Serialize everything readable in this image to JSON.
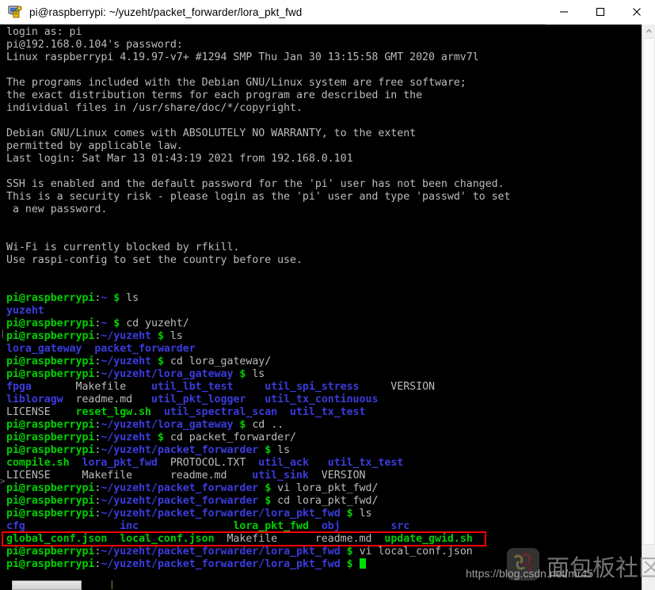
{
  "window": {
    "title": "pi@raspberrypi: ~/yuzeht/packet_forwarder/lora_pkt_fwd",
    "icon": "putty-computer-icon",
    "controls": {
      "minimize": "minimize-icon",
      "maximize": "maximize-icon",
      "close": "close-icon"
    }
  },
  "terminal": {
    "colors": {
      "background": "#000000",
      "foreground": "#bbbbbb",
      "prompt_green": "#00d000",
      "directory_blue": "#3b3bdd",
      "executable_green": "#00d000",
      "cursor": "#00e000",
      "highlight_box": "#ff0000"
    },
    "lines": [
      {
        "segments": [
          {
            "text": "login as: pi",
            "color": "white"
          }
        ]
      },
      {
        "segments": [
          {
            "text": "pi@192.168.0.104's password:",
            "color": "white"
          }
        ]
      },
      {
        "segments": [
          {
            "text": "Linux raspberrypi 4.19.97-v7+ #1294 SMP Thu Jan 30 13:15:58 GMT 2020 armv7l",
            "color": "white"
          }
        ]
      },
      {
        "segments": [
          {
            "text": "",
            "color": "white"
          }
        ]
      },
      {
        "segments": [
          {
            "text": "The programs included with the Debian GNU/Linux system are free software;",
            "color": "white"
          }
        ]
      },
      {
        "segments": [
          {
            "text": "the exact distribution terms for each program are described in the",
            "color": "white"
          }
        ]
      },
      {
        "segments": [
          {
            "text": "individual files in /usr/share/doc/*/copyright.",
            "color": "white"
          }
        ]
      },
      {
        "segments": [
          {
            "text": "",
            "color": "white"
          }
        ]
      },
      {
        "segments": [
          {
            "text": "Debian GNU/Linux comes with ABSOLUTELY NO WARRANTY, to the extent",
            "color": "white"
          }
        ]
      },
      {
        "segments": [
          {
            "text": "permitted by applicable law.",
            "color": "white"
          }
        ]
      },
      {
        "segments": [
          {
            "text": "Last login: Sat Mar 13 01:43:19 2021 from 192.168.0.101",
            "color": "white"
          }
        ]
      },
      {
        "segments": [
          {
            "text": "",
            "color": "white"
          }
        ]
      },
      {
        "segments": [
          {
            "text": "SSH is enabled and the default password for the 'pi' user has not been changed.",
            "color": "white"
          }
        ]
      },
      {
        "segments": [
          {
            "text": "This is a security risk - please login as the 'pi' user and type 'passwd' to set",
            "color": "white"
          }
        ]
      },
      {
        "segments": [
          {
            "text": " a new password.",
            "color": "white"
          }
        ]
      },
      {
        "segments": [
          {
            "text": "",
            "color": "white"
          }
        ]
      },
      {
        "segments": [
          {
            "text": "",
            "color": "white"
          }
        ]
      },
      {
        "segments": [
          {
            "text": "Wi-Fi is currently blocked by rfkill.",
            "color": "white"
          }
        ]
      },
      {
        "segments": [
          {
            "text": "Use raspi-config to set the country before use.",
            "color": "white"
          }
        ]
      },
      {
        "segments": [
          {
            "text": "",
            "color": "white"
          }
        ]
      },
      {
        "segments": [
          {
            "text": "",
            "color": "white"
          }
        ]
      },
      {
        "segments": [
          {
            "text": "pi@raspberrypi",
            "color": "green"
          },
          {
            "text": ":",
            "color": "white"
          },
          {
            "text": "~",
            "color": "blue"
          },
          {
            "text": " ",
            "color": "white"
          },
          {
            "text": "$",
            "color": "green"
          },
          {
            "text": " ls",
            "color": "white"
          }
        ]
      },
      {
        "segments": [
          {
            "text": "yuzeht",
            "color": "blue"
          }
        ]
      },
      {
        "segments": [
          {
            "text": "pi@raspberrypi",
            "color": "green"
          },
          {
            "text": ":",
            "color": "white"
          },
          {
            "text": "~",
            "color": "blue"
          },
          {
            "text": " ",
            "color": "white"
          },
          {
            "text": "$",
            "color": "green"
          },
          {
            "text": " cd yuzeht/",
            "color": "white"
          }
        ]
      },
      {
        "segments": [
          {
            "text": "pi@raspberrypi",
            "color": "green"
          },
          {
            "text": ":",
            "color": "white"
          },
          {
            "text": "~/yuzeht",
            "color": "blue"
          },
          {
            "text": " ",
            "color": "white"
          },
          {
            "text": "$",
            "color": "green"
          },
          {
            "text": " ls",
            "color": "white"
          }
        ]
      },
      {
        "segments": [
          {
            "text": "lora_gateway",
            "color": "blue"
          },
          {
            "text": "  ",
            "color": "white"
          },
          {
            "text": "packet_forwarder",
            "color": "blue"
          }
        ]
      },
      {
        "segments": [
          {
            "text": "pi@raspberrypi",
            "color": "green"
          },
          {
            "text": ":",
            "color": "white"
          },
          {
            "text": "~/yuzeht",
            "color": "blue"
          },
          {
            "text": " ",
            "color": "white"
          },
          {
            "text": "$",
            "color": "green"
          },
          {
            "text": " cd lora_gateway/",
            "color": "white"
          }
        ]
      },
      {
        "segments": [
          {
            "text": "pi@raspberrypi",
            "color": "green"
          },
          {
            "text": ":",
            "color": "white"
          },
          {
            "text": "~/yuzeht/lora_gateway",
            "color": "blue"
          },
          {
            "text": " ",
            "color": "white"
          },
          {
            "text": "$",
            "color": "green"
          },
          {
            "text": " ls",
            "color": "white"
          }
        ]
      },
      {
        "segments": [
          {
            "text": "fpga",
            "color": "blue"
          },
          {
            "text": "       Makefile    ",
            "color": "white"
          },
          {
            "text": "util_lbt_test",
            "color": "blue"
          },
          {
            "text": "     ",
            "color": "white"
          },
          {
            "text": "util_spi_stress",
            "color": "blue"
          },
          {
            "text": "     VERSION",
            "color": "white"
          }
        ]
      },
      {
        "segments": [
          {
            "text": "libloragw",
            "color": "blue"
          },
          {
            "text": "  readme.md   ",
            "color": "white"
          },
          {
            "text": "util_pkt_logger",
            "color": "blue"
          },
          {
            "text": "   ",
            "color": "white"
          },
          {
            "text": "util_tx_continuous",
            "color": "blue"
          }
        ]
      },
      {
        "segments": [
          {
            "text": "LICENSE    ",
            "color": "white"
          },
          {
            "text": "reset_lgw.sh",
            "color": "green"
          },
          {
            "text": "  ",
            "color": "white"
          },
          {
            "text": "util_spectral_scan",
            "color": "blue"
          },
          {
            "text": "  ",
            "color": "white"
          },
          {
            "text": "util_tx_test",
            "color": "blue"
          }
        ]
      },
      {
        "segments": [
          {
            "text": "pi@raspberrypi",
            "color": "green"
          },
          {
            "text": ":",
            "color": "white"
          },
          {
            "text": "~/yuzeht/lora_gateway",
            "color": "blue"
          },
          {
            "text": " ",
            "color": "white"
          },
          {
            "text": "$",
            "color": "green"
          },
          {
            "text": " cd ..",
            "color": "white"
          }
        ]
      },
      {
        "segments": [
          {
            "text": "pi@raspberrypi",
            "color": "green"
          },
          {
            "text": ":",
            "color": "white"
          },
          {
            "text": "~/yuzeht",
            "color": "blue"
          },
          {
            "text": " ",
            "color": "white"
          },
          {
            "text": "$",
            "color": "green"
          },
          {
            "text": " cd packet_forwarder/",
            "color": "white"
          }
        ]
      },
      {
        "segments": [
          {
            "text": "pi@raspberrypi",
            "color": "green"
          },
          {
            "text": ":",
            "color": "white"
          },
          {
            "text": "~/yuzeht/packet_forwarder",
            "color": "blue"
          },
          {
            "text": " ",
            "color": "white"
          },
          {
            "text": "$",
            "color": "green"
          },
          {
            "text": " ls",
            "color": "white"
          }
        ]
      },
      {
        "segments": [
          {
            "text": "compile.sh",
            "color": "green"
          },
          {
            "text": "  ",
            "color": "white"
          },
          {
            "text": "lora_pkt_fwd",
            "color": "blue"
          },
          {
            "text": "  PROTOCOL.TXT  ",
            "color": "white"
          },
          {
            "text": "util_ack",
            "color": "blue"
          },
          {
            "text": "   ",
            "color": "white"
          },
          {
            "text": "util_tx_test",
            "color": "blue"
          }
        ]
      },
      {
        "segments": [
          {
            "text": "LICENSE     Makefile      readme.md    ",
            "color": "white"
          },
          {
            "text": "util_sink",
            "color": "blue"
          },
          {
            "text": "  VERSION",
            "color": "white"
          }
        ]
      },
      {
        "segments": [
          {
            "text": "pi@raspberrypi",
            "color": "green"
          },
          {
            "text": ":",
            "color": "white"
          },
          {
            "text": "~/yuzeht/packet_forwarder",
            "color": "blue"
          },
          {
            "text": " ",
            "color": "white"
          },
          {
            "text": "$",
            "color": "green"
          },
          {
            "text": " vi lora_pkt_fwd/",
            "color": "white"
          }
        ]
      },
      {
        "segments": [
          {
            "text": "pi@raspberrypi",
            "color": "green"
          },
          {
            "text": ":",
            "color": "white"
          },
          {
            "text": "~/yuzeht/packet_forwarder",
            "color": "blue"
          },
          {
            "text": " ",
            "color": "white"
          },
          {
            "text": "$",
            "color": "green"
          },
          {
            "text": " cd lora_pkt_fwd/",
            "color": "white"
          }
        ]
      },
      {
        "segments": [
          {
            "text": "pi@raspberrypi",
            "color": "green"
          },
          {
            "text": ":",
            "color": "white"
          },
          {
            "text": "~/yuzeht/packet_forwarder/lora_pkt_fwd",
            "color": "blue"
          },
          {
            "text": " ",
            "color": "white"
          },
          {
            "text": "$",
            "color": "green"
          },
          {
            "text": " ls",
            "color": "white"
          }
        ]
      },
      {
        "segments": [
          {
            "text": "cfg",
            "color": "blue"
          },
          {
            "text": "               ",
            "color": "white"
          },
          {
            "text": "inc",
            "color": "blue"
          },
          {
            "text": "               ",
            "color": "white"
          },
          {
            "text": "lora_pkt_fwd",
            "color": "green"
          },
          {
            "text": "  ",
            "color": "white"
          },
          {
            "text": "obj",
            "color": "blue"
          },
          {
            "text": "        ",
            "color": "white"
          },
          {
            "text": "src",
            "color": "blue"
          }
        ]
      },
      {
        "segments": [
          {
            "text": "global_conf.json",
            "color": "green"
          },
          {
            "text": "  ",
            "color": "white"
          },
          {
            "text": "local_conf.json",
            "color": "green"
          },
          {
            "text": "  Makefile      readme.md  ",
            "color": "white"
          },
          {
            "text": "update_gwid.sh",
            "color": "green"
          }
        ]
      },
      {
        "segments": [
          {
            "text": "pi@raspberrypi",
            "color": "green"
          },
          {
            "text": ":",
            "color": "white"
          },
          {
            "text": "~/yuzeht/packet_forwarder/lora_pkt_fwd",
            "color": "blue"
          },
          {
            "text": " ",
            "color": "white"
          },
          {
            "text": "$",
            "color": "green"
          },
          {
            "text": " vi local_conf.json",
            "color": "white"
          }
        ]
      },
      {
        "segments": [
          {
            "text": "pi@raspberrypi",
            "color": "green"
          },
          {
            "text": ":",
            "color": "white"
          },
          {
            "text": "~/yuzeht/packet_forwarder/lora_pkt_fwd",
            "color": "blue"
          },
          {
            "text": " ",
            "color": "white"
          },
          {
            "text": "$",
            "color": "green"
          },
          {
            "text": " ",
            "color": "white"
          }
        ],
        "cursor": true
      }
    ]
  },
  "annotation": {
    "highlight_label": "vi local_conf.json"
  },
  "watermark": {
    "url": "https://blog.csdn.net/mr45",
    "chinese_text": "面包板社区"
  },
  "scrollbar": {
    "up_arrow": "chevron-up-icon"
  }
}
